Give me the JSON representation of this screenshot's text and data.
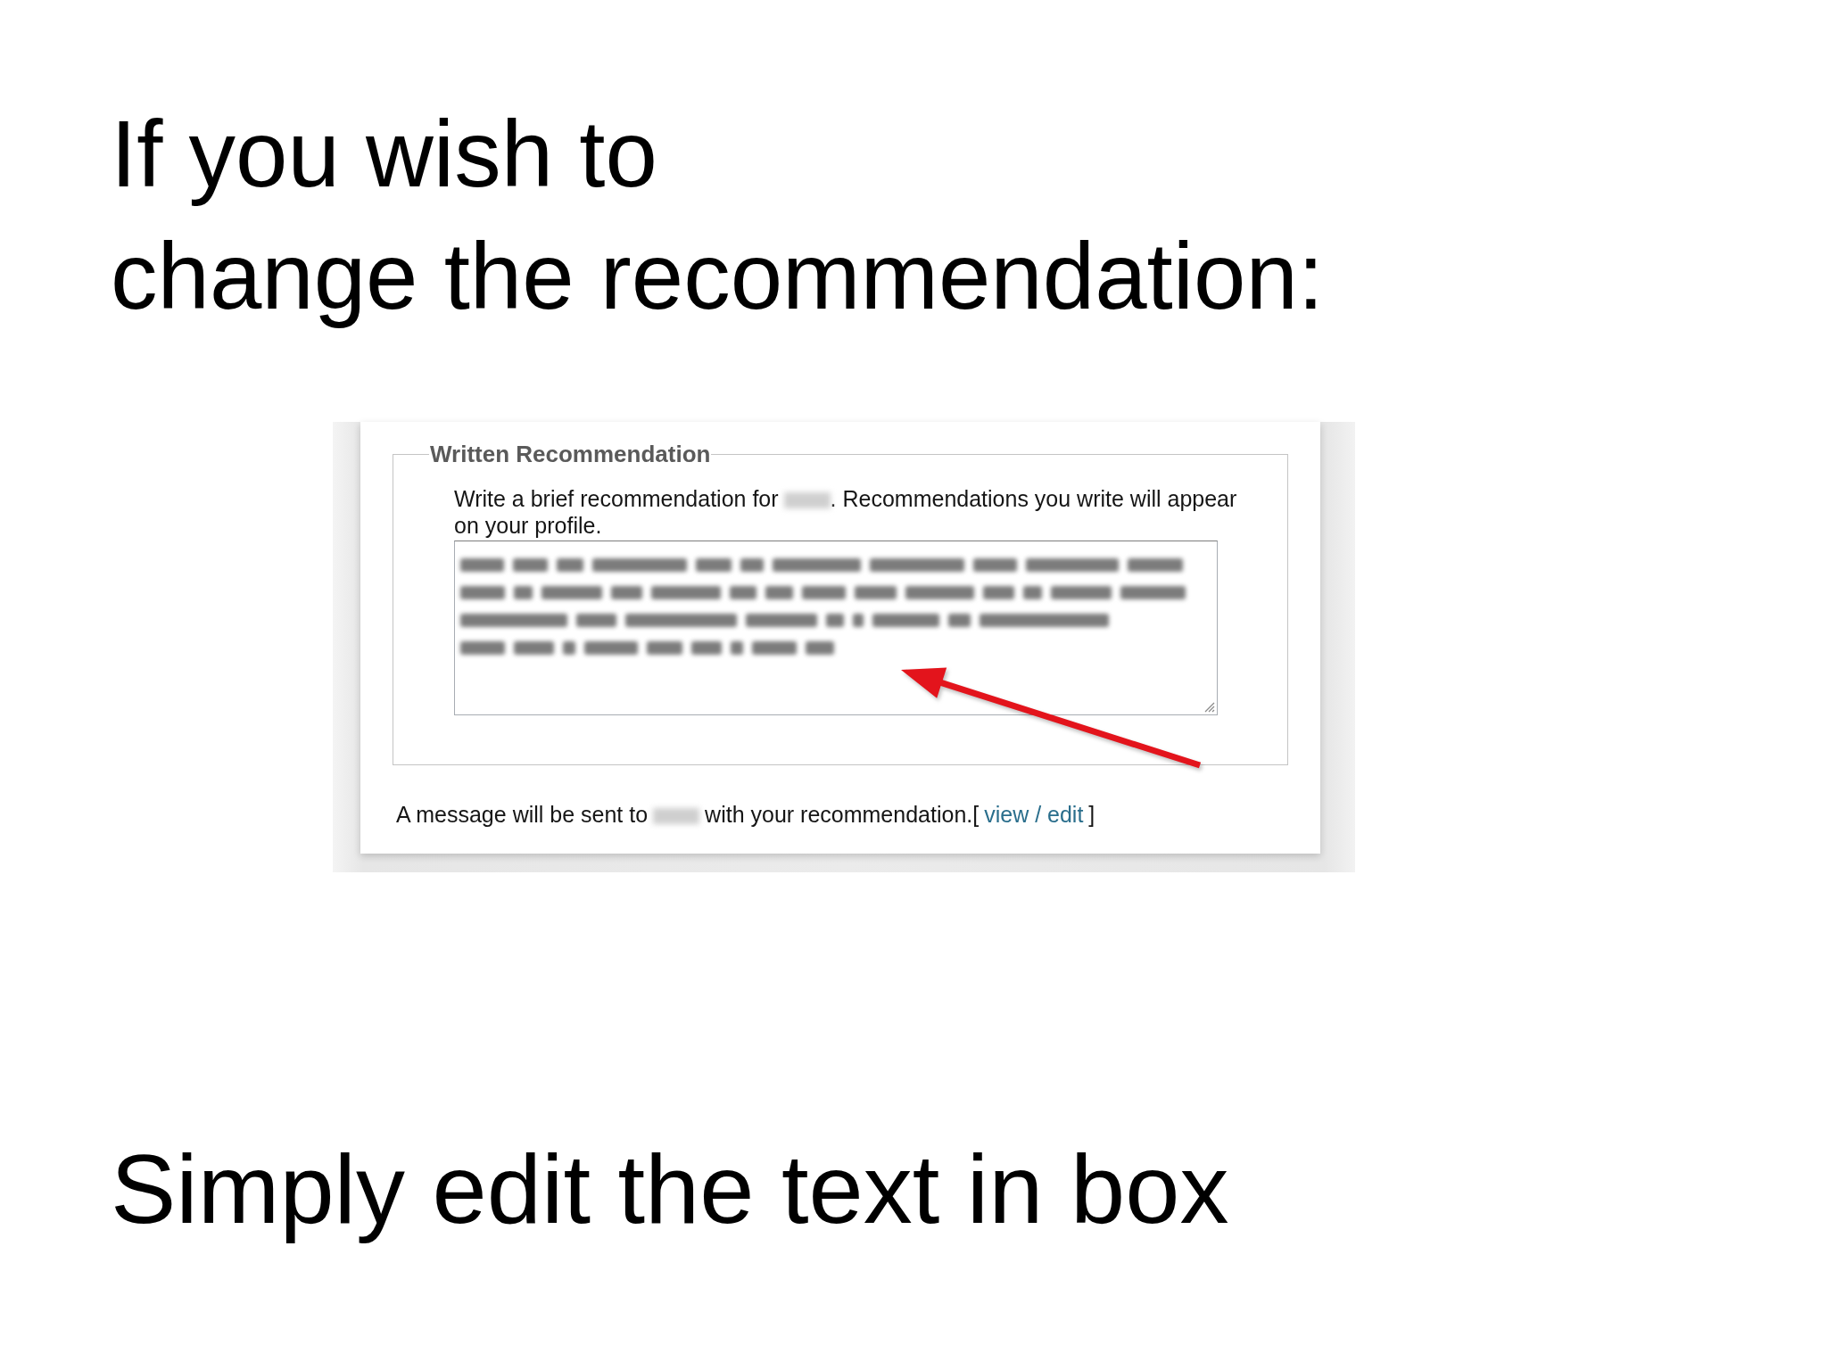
{
  "slide": {
    "title_lines": [
      "If you wish to",
      "change the recommendation:"
    ],
    "caption": "Simply edit the text in box"
  },
  "screenshot": {
    "section_legend": "Written Recommendation",
    "description": {
      "before_name": "Write a brief recommendation for",
      "after_name": ". Recommendations you write will appear",
      "second_line": "on your profile."
    },
    "footer": {
      "before_name": "A message will be sent to",
      "after_name": "with your recommendation.",
      "link_open": "[",
      "link": "view / edit",
      "link_close": "]"
    }
  }
}
